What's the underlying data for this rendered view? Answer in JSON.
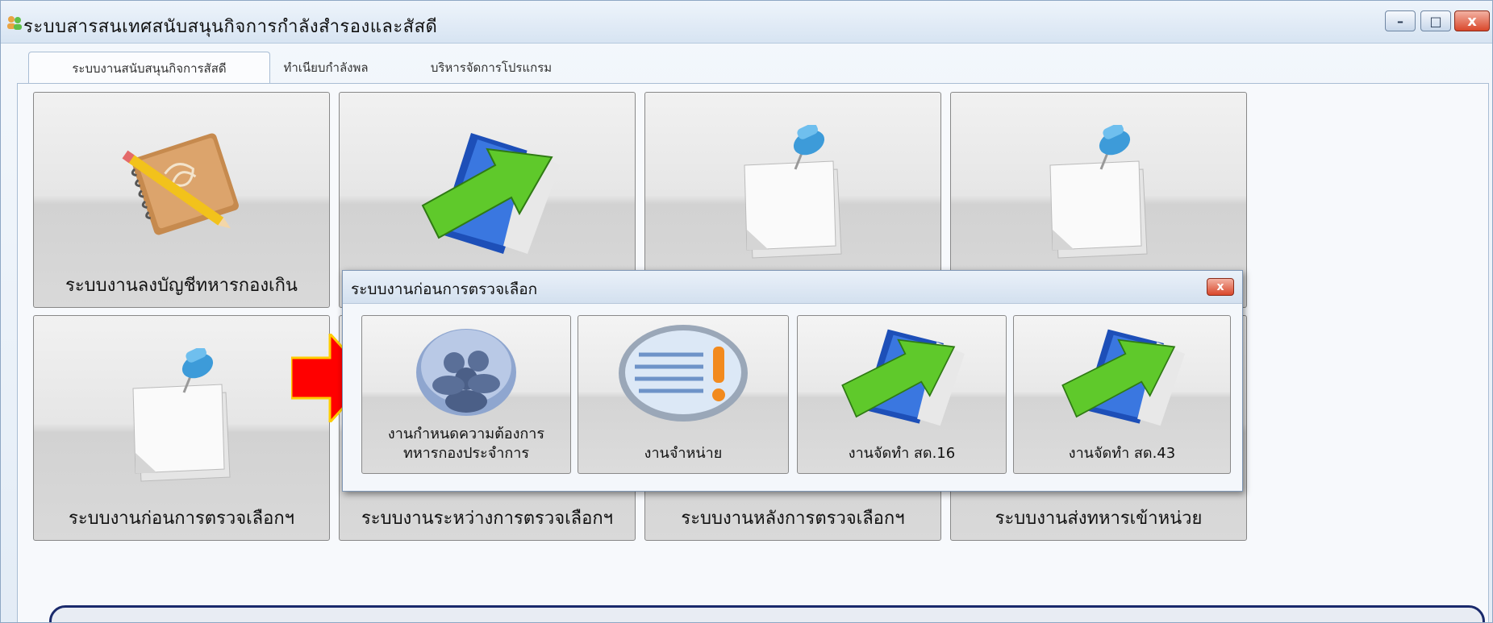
{
  "window": {
    "title": "ระบบสารสนเทศสนับสนุนกิจการกำลังสำรองและสัสดี",
    "controls": {
      "minimize": "–",
      "maximize": "□",
      "close": "x"
    }
  },
  "tabs": [
    {
      "label": "ระบบงานสนับสนุนกิจการสัสดี",
      "active": true
    },
    {
      "label": "ทำเนียบกำลังพล",
      "active": false
    },
    {
      "label": "บริหารจัดการโปรแกรม",
      "active": false
    }
  ],
  "tiles": [
    {
      "label": "ระบบงานลงบัญชีทหารกองเกิน",
      "icon": "notebook-pencil-icon"
    },
    {
      "label": "",
      "icon": "book-arrow-icon"
    },
    {
      "label": "",
      "icon": "pinned-note-icon"
    },
    {
      "label": "",
      "icon": "pinned-note-icon"
    },
    {
      "label": "ระบบงานก่อนการตรวจเลือกฯ",
      "icon": "pinned-note-icon"
    },
    {
      "label": "ระบบงานระหว่างการตรวจเลือกฯ",
      "icon": ""
    },
    {
      "label": "ระบบงานหลังการตรวจเลือกฯ",
      "icon": ""
    },
    {
      "label": "ระบบงานส่งทหารเข้าหน่วย",
      "icon": ""
    }
  ],
  "dialog": {
    "title": "ระบบงานก่อนการตรวจเลือก",
    "close": "x",
    "items": [
      {
        "label_line1": "งานกำหนดความต้องการ",
        "label_line2": "ทหารกองประจำการ",
        "icon": "users-icon"
      },
      {
        "label_line1": "งานจำหน่าย",
        "label_line2": "",
        "icon": "list-alert-icon"
      },
      {
        "label_line1": "งานจัดทำ สด.16",
        "label_line2": "",
        "icon": "book-arrow-icon"
      },
      {
        "label_line1": "งานจัดทำ สด.43",
        "label_line2": "",
        "icon": "book-arrow-icon"
      }
    ]
  },
  "colors": {
    "accent_arrow": "#ff0000",
    "arrow_green": "#58c12a",
    "book_blue": "#1d4fb8",
    "pin_blue": "#3d9bd9"
  }
}
